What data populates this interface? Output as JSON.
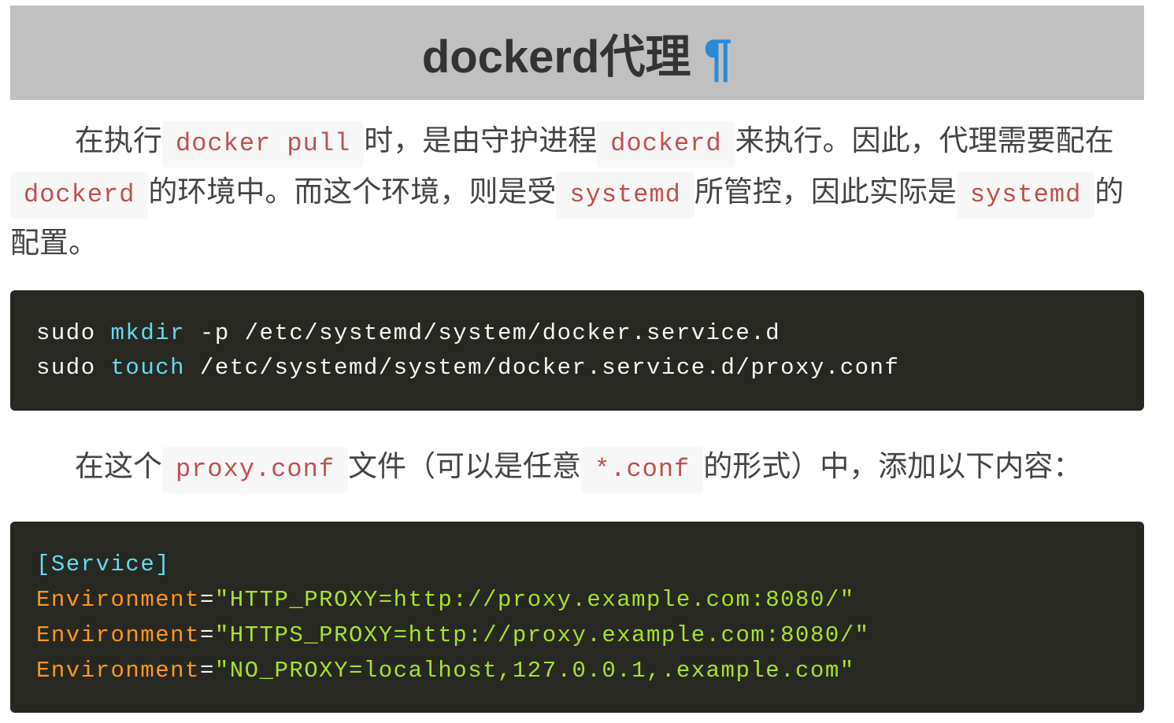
{
  "heading": {
    "title": "dockerd代理",
    "anchor_symbol": "¶"
  },
  "paragraph1": {
    "t1": "在执行",
    "c1": "docker pull",
    "t2": "时，是由守护进程",
    "c2": "dockerd",
    "t3": "来执行。因此，代理需要配在",
    "c3": "dockerd",
    "t4": "的环境中。而这个环境，则是受",
    "c4": "systemd",
    "t5": "所管控，因此实际是",
    "c5": "systemd",
    "t6": "的配置。"
  },
  "codeblock1": {
    "lines": [
      {
        "a": "sudo ",
        "cmd": "mkdir",
        "rest": " -p /etc/systemd/system/docker.service.d"
      },
      {
        "a": "sudo ",
        "cmd": "touch",
        "rest": " /etc/systemd/system/docker.service.d/proxy.conf"
      }
    ]
  },
  "paragraph2": {
    "t1": "在这个",
    "c1": "proxy.conf",
    "t2": "文件（可以是任意",
    "c2": "*.conf",
    "t3": "的形式）中，添加以下内容："
  },
  "codeblock2": {
    "section": "[Service]",
    "lines": [
      {
        "key": "Environment",
        "eq": "=",
        "value": "\"HTTP_PROXY=http://proxy.example.com:8080/\""
      },
      {
        "key": "Environment",
        "eq": "=",
        "value": "\"HTTPS_PROXY=http://proxy.example.com:8080/\""
      },
      {
        "key": "Environment",
        "eq": "=",
        "value": "\"NO_PROXY=localhost,127.0.0.1,.example.com\""
      }
    ]
  },
  "colors": {
    "heading_bg": "#c0c0c0",
    "heading_text": "#333333",
    "anchor": "#2a8ad8",
    "body_text": "#444444",
    "inline_code_text": "#c0504d",
    "inline_code_bg": "#f7f7f7",
    "code_bg": "#272822",
    "code_plain": "#f8f8f2",
    "code_command": "#66d9ef",
    "code_key": "#fd971f",
    "code_string": "#a6e22e"
  }
}
